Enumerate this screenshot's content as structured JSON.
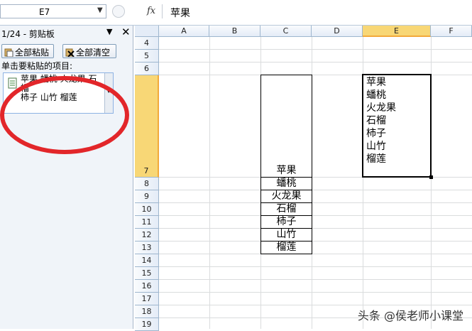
{
  "formula_bar": {
    "name_box": "E7",
    "fx_label": "fx",
    "content": "苹果"
  },
  "clipboard_pane": {
    "title": "1/24 - 剪贴板",
    "paste_all_label": "全部粘贴",
    "clear_all_label": "全部清空",
    "hint": "单击要粘贴的项目:",
    "item_text": "苹果 蟠桃 火龙果 石榴\n柿子 山竹 榴莲"
  },
  "columns": [
    "A",
    "B",
    "C",
    "D",
    "E",
    "F"
  ],
  "rows": [
    "4",
    "5",
    "6",
    "7",
    "8",
    "9",
    "10",
    "11",
    "12",
    "13",
    "14",
    "15",
    "16",
    "17",
    "18",
    "19"
  ],
  "column_c_values": [
    "苹果",
    "蟠桃",
    "火龙果",
    "石榴",
    "柿子",
    "山竹",
    "榴莲"
  ],
  "e7_lines": [
    "苹果",
    "蟠桃",
    "火龙果",
    "石榴",
    "柿子",
    "山竹",
    "榴莲"
  ],
  "watermark": "头条 @侯老师小课堂",
  "colors": {
    "selected_header": "#f8d776",
    "annotation_circle": "#e2262a"
  }
}
